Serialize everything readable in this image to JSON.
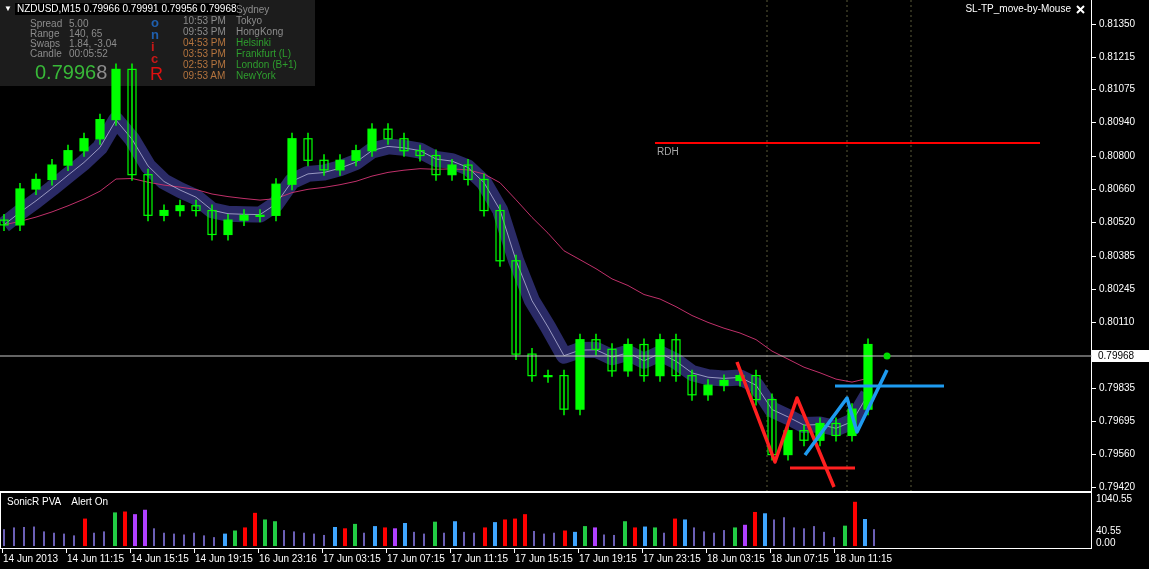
{
  "chart_window": {
    "menu_glyph": "▼",
    "title": "NZDUSD,M15  0.79966 0.79991 0.79956 0.79968",
    "expert_label": "SL-TP_move-by-Mouse"
  },
  "info_panel": {
    "stats": [
      {
        "label": "Spread",
        "value": "5.00"
      },
      {
        "label": "Range",
        "value": "140, 65"
      },
      {
        "label": "Swaps",
        "value": "1.84, -3.04"
      },
      {
        "label": "Candle",
        "value": "00:05:52"
      }
    ],
    "price_main": "0.7996",
    "price_last_digit": "8",
    "logo_letters": [
      {
        "text": "o",
        "color": "#1f5fae"
      },
      {
        "text": "n",
        "color": "#1f5fae"
      },
      {
        "text": "i",
        "color": "#c81818"
      },
      {
        "text": "c",
        "color": "#c81818"
      },
      {
        "text": "R",
        "color": "#e01010"
      }
    ],
    "sessions": [
      {
        "city": "Sydney",
        "open": false
      },
      {
        "time": "10:53 PM",
        "city": "Tokyo",
        "open": false
      },
      {
        "time": "09:53 PM",
        "city": "HongKong",
        "open": false
      },
      {
        "time": "04:53 PM",
        "city": "Helsinki",
        "open": true
      },
      {
        "time": "03:53 PM",
        "city": "Frankfurt  (L)",
        "open": true
      },
      {
        "time": "02:53 PM",
        "city": "London  (B+1)",
        "open": true
      },
      {
        "time": "09:53 AM",
        "city": "NewYork",
        "open": true
      }
    ]
  },
  "price_chart": {
    "rdh_label": "RDH"
  },
  "price_axis": {
    "labels": [
      "0.81350",
      "0.81215",
      "0.81075",
      "0.80940",
      "0.80800",
      "0.80660",
      "0.80520",
      "0.80385",
      "0.80245",
      "0.80110",
      "0.79835",
      "0.79695",
      "0.79560",
      "0.79420"
    ],
    "current_price": "0.79968"
  },
  "volume_panel": {
    "title": "SonicR PVA",
    "alert": "Alert On",
    "axis_labels": [
      "1040.55",
      "40.55",
      "0.00"
    ]
  },
  "time_axis": {
    "labels": [
      "14 Jun 2013",
      "14 Jun 11:15",
      "14 Jun 15:15",
      "14 Jun 19:15",
      "16 Jun 23:16",
      "17 Jun 03:15",
      "17 Jun 07:15",
      "17 Jun 11:15",
      "17 Jun 15:15",
      "17 Jun 19:15",
      "17 Jun 23:15",
      "18 Jun 03:15",
      "18 Jun 07:15",
      "18 Jun 11:15"
    ]
  }
}
